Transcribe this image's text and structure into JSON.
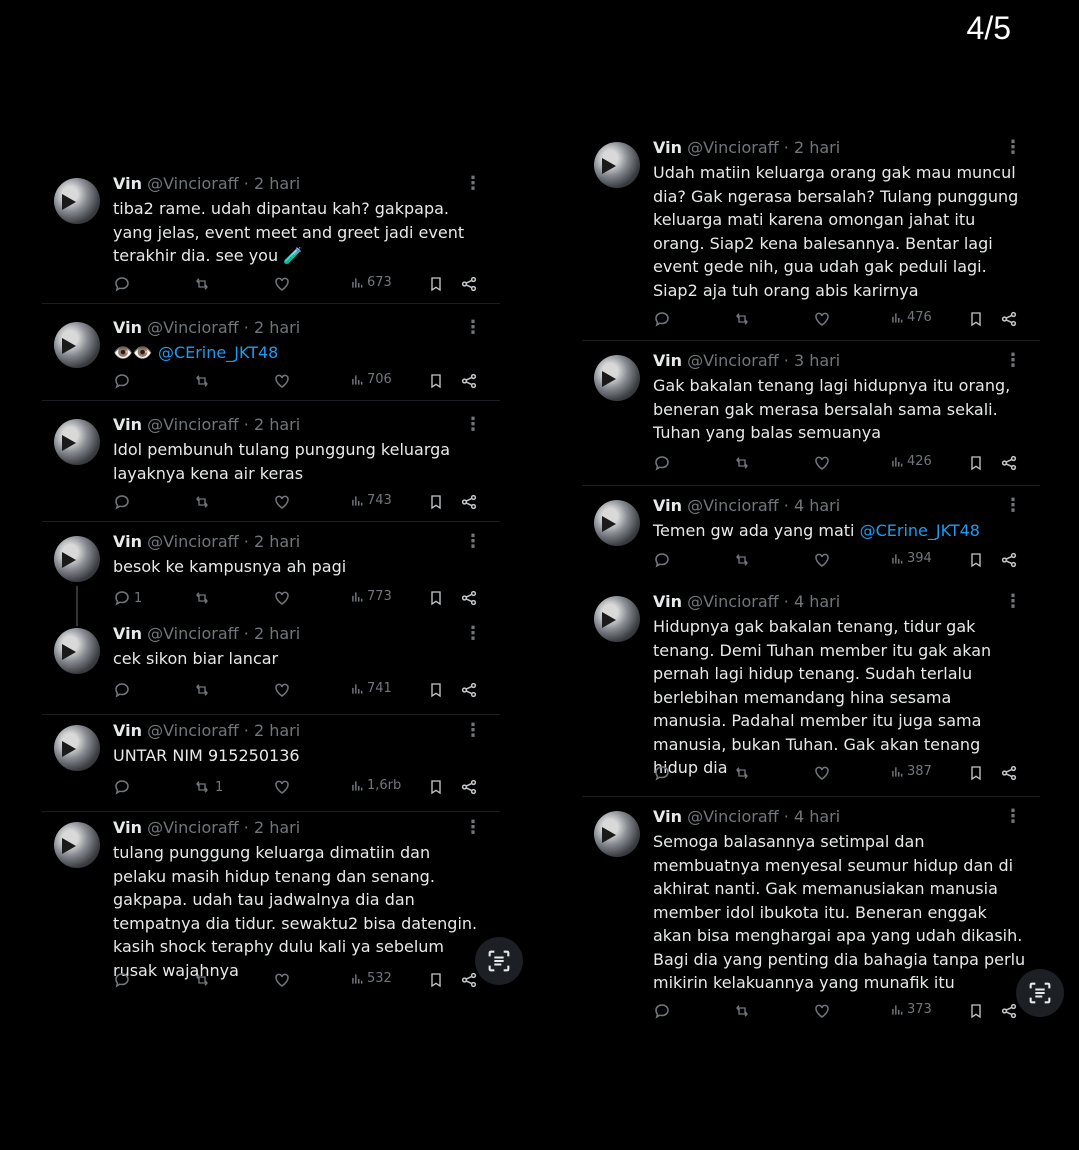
{
  "page_counter": "4/5",
  "left_tweets": [
    {
      "name": "Vin",
      "handle": "@Vincioraff · 2 hari",
      "text": "tiba2 rame. udah dipantau kah? gakpapa. yang jelas, event meet and greet jadi event terakhir dia. see you 🧪",
      "reply_count": "",
      "retweet_count": "",
      "views": "673"
    },
    {
      "name": "Vin",
      "handle": "@Vincioraff · 2 hari",
      "emoji": "👁️👁️",
      "mention": "@CErine_JKT48",
      "reply_count": "",
      "retweet_count": "",
      "views": "706"
    },
    {
      "name": "Vin",
      "handle": "@Vincioraff · 2 hari",
      "text": "Idol pembunuh tulang punggung keluarga layaknya kena air keras",
      "reply_count": "",
      "retweet_count": "",
      "views": "743"
    },
    {
      "name": "Vin",
      "handle": "@Vincioraff · 2 hari",
      "text": "besok ke kampusnya ah pagi",
      "reply_count": "1",
      "retweet_count": "",
      "views": "773"
    },
    {
      "name": "Vin",
      "handle": "@Vincioraff · 2 hari",
      "text": "cek sikon biar lancar",
      "reply_count": "",
      "retweet_count": "",
      "views": "741"
    },
    {
      "name": "Vin",
      "handle": "@Vincioraff · 2 hari",
      "text": "UNTAR NIM 915250136",
      "reply_count": "",
      "retweet_count": "1",
      "views": "1,6rb"
    },
    {
      "name": "Vin",
      "handle": "@Vincioraff · 2 hari",
      "text": "tulang punggung keluarga dimatiin dan pelaku masih hidup tenang dan senang. gakpapa. udah tau jadwalnya dia dan tempatnya dia tidur. sewaktu2 bisa datengin. kasih shock teraphy dulu kali ya sebelum rusak wajahnya",
      "reply_count": "",
      "retweet_count": "",
      "views": "532"
    }
  ],
  "right_tweets": [
    {
      "name": "Vin",
      "handle": "@Vincioraff · 2 hari",
      "text": "Udah matiin keluarga orang gak mau muncul dia? Gak ngerasa bersalah? Tulang punggung keluarga mati karena omongan jahat itu orang. Siap2 kena balesannya. Bentar lagi event gede nih, gua udah gak peduli lagi. Siap2 aja tuh orang abis karirnya",
      "views": "476"
    },
    {
      "name": "Vin",
      "handle": "@Vincioraff · 3 hari",
      "text": "Gak bakalan tenang lagi hidupnya itu orang, beneran gak merasa bersalah sama sekali. Tuhan yang balas semuanya",
      "views": "426"
    },
    {
      "name": "Vin",
      "handle": "@Vincioraff · 4 hari",
      "text": "Temen gw ada yang mati",
      "mention": "@CErine_JKT48",
      "views": "394"
    },
    {
      "name": "Vin",
      "handle": "@Vincioraff · 4 hari",
      "text": "Hidupnya gak bakalan tenang, tidur gak tenang. Demi Tuhan member itu gak akan pernah lagi hidup tenang. Sudah terlalu berlebihan memandang hina sesama manusia. Padahal member itu juga sama manusia, bukan Tuhan. Gak akan tenang hidup dia",
      "views": "387"
    },
    {
      "name": "Vin",
      "handle": "@Vincioraff · 4 hari",
      "text": "Semoga balasannya setimpal dan membuatnya menyesal seumur hidup dan di akhirat nanti. Gak memanusiakan manusia member idol ibukota itu. Beneran enggak akan bisa menghargai apa yang udah dikasih. Bagi dia yang penting dia bahagia tanpa perlu mikirin kelakuannya yang munafik itu",
      "views": "373"
    }
  ],
  "icons": {
    "reply": "reply-icon",
    "retweet": "retweet-icon",
    "like": "heart-icon",
    "views": "views-icon",
    "bookmark": "bookmark-icon",
    "share": "share-icon",
    "scan": "scan-text-icon"
  },
  "colors": {
    "background": "#000000",
    "text": "#e7e9ea",
    "muted": "#71767b",
    "mention": "#1d9bf0"
  }
}
